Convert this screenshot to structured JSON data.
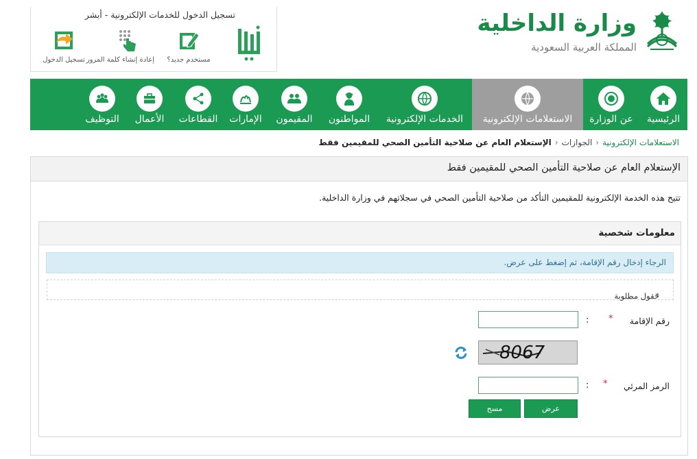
{
  "header": {
    "ministry_name": "وزارة الداخلية",
    "kingdom_name": "المملكة العربية السعودية",
    "absher": {
      "title": "تسجيل الدخول للخدمات الإلكترونية - أبشر",
      "actions": [
        {
          "label": "تسجيل الدخول",
          "icon": "login-arrow-icon",
          "color": "#f5a623"
        },
        {
          "label": "إعادة إنشاء كلمة المرور",
          "icon": "keypad-hand-icon",
          "color": "#2e9e5b"
        },
        {
          "label": "مستخدم جديد؟",
          "icon": "edit-form-icon",
          "color": "#2e9e5b"
        }
      ]
    }
  },
  "nav": {
    "items": [
      {
        "label": "الرئيسية",
        "icon": "home-icon"
      },
      {
        "label": "عن الوزارة",
        "icon": "emblem-icon"
      },
      {
        "label": "الاستعلامات الإلكترونية",
        "icon": "globe-hand-icon",
        "active": true
      },
      {
        "label": "الخدمات الإلكترونية",
        "icon": "globe-icon"
      },
      {
        "label": "المواطنون",
        "icon": "citizen-icon"
      },
      {
        "label": "المقيمون",
        "icon": "residents-icon"
      },
      {
        "label": "الإمارات",
        "icon": "emirates-icon"
      },
      {
        "label": "القطاعات",
        "icon": "share-network-icon"
      },
      {
        "label": "الأعمال",
        "icon": "briefcase-icon"
      },
      {
        "label": "التوظيف",
        "icon": "people-group-icon"
      }
    ]
  },
  "breadcrumb": {
    "link": "الاستعلامات الإلكترونية",
    "middle": "الجوازات",
    "current": "الإستعلام العام عن صلاحية التأمين الصحي للمقيمين فقط"
  },
  "page": {
    "title": "الإستعلام العام عن صلاحية التأمين الصحي للمقيمين فقط",
    "description": "تتيح هذه الخدمة الإلكترونية للمقيمين التأكد من صلاحية التأمين الصحي في سجلاتهم في وزارة الداخلية."
  },
  "form": {
    "section_title": "معلومات شخصية",
    "info_message": "الرجاء إدخال رقم الإقامة، ثم إضغط على عرض.",
    "required_note": "حقول مطلوبة",
    "iqama_label": "رقم الإقامة",
    "iqama_value": "",
    "captcha_text": "8067",
    "captcha_label": "الرمز المرئي",
    "captcha_value": "",
    "submit_label": "عرض",
    "clear_label": "مسح",
    "required_mark": "*",
    "colon": ":"
  },
  "colors": {
    "brand_green": "#1a9a52",
    "active_gray": "#9e9e9e",
    "alert_blue": "#d9edf7",
    "required_red": "#d9262b"
  }
}
